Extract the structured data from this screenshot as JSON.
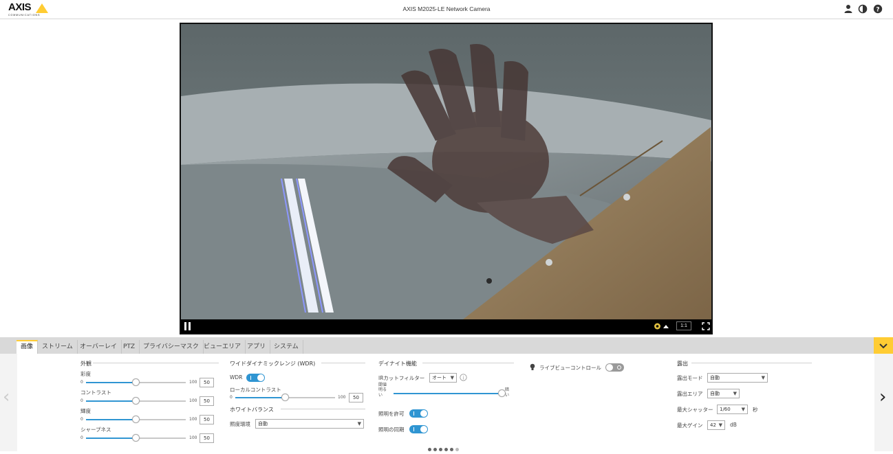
{
  "header": {
    "logo_word": "AXIS",
    "logo_tagline": "COMMUNICATIONS",
    "title": "AXIS M2025-LE Network Camera",
    "icons": [
      "user-icon",
      "contrast-icon",
      "help-icon"
    ]
  },
  "video": {
    "ratio_label": "1:1",
    "controls": [
      "pause-icon",
      "settings-icon",
      "fullscreen-icon"
    ]
  },
  "tabs": [
    "画像",
    "ストリーム",
    "オーバーレイ",
    "PTZ",
    "プライバシーマスク",
    "ビューエリア",
    "アプリ",
    "システム"
  ],
  "active_tab": 0,
  "appearance": {
    "title": "外観",
    "sliders": [
      {
        "label": "彩度",
        "min": "0",
        "max": "100",
        "value": "50"
      },
      {
        "label": "コントラスト",
        "min": "0",
        "max": "100",
        "value": "50"
      },
      {
        "label": "輝度",
        "min": "0",
        "max": "100",
        "value": "50"
      },
      {
        "label": "シャープネス",
        "min": "0",
        "max": "100",
        "value": "50"
      }
    ]
  },
  "wdr": {
    "title": "ワイドダイナミックレンジ (WDR)",
    "wdr_label": "WDR",
    "wdr_on": true,
    "local_contrast_label": "ローカルコントラスト",
    "min": "0",
    "max": "100",
    "value": "50"
  },
  "white_balance": {
    "title": "ホワイトバランス",
    "env_label": "照度環境",
    "env_value": "自動"
  },
  "day_night": {
    "title": "デイナイト機能",
    "ir_label": "IRカットフィルター",
    "ir_value": "オート",
    "threshold_label": "閾値",
    "bright_label": "明る\nい",
    "dark_label": "暗\nい",
    "threshold_fraction": 1.0,
    "allow_light_label": "照明を許可",
    "allow_light_on": true,
    "sync_light_label": "照明の同期",
    "sync_light_on": true
  },
  "live_view": {
    "label": "ライブビューコントロール",
    "on": false
  },
  "exposure": {
    "title": "露出",
    "mode_label": "露出モード",
    "mode_value": "自動",
    "area_label": "露出エリア",
    "area_value": "自動",
    "shutter_label": "最大シャッター",
    "shutter_value": "1/60",
    "shutter_unit": "秒",
    "gain_label": "最大ゲイン",
    "gain_value": "42",
    "gain_unit": "dB"
  },
  "pager": {
    "count": 6,
    "active": 0
  },
  "colors": {
    "accent": "#ffcc33",
    "toggle_blue": "#2f95d2"
  }
}
